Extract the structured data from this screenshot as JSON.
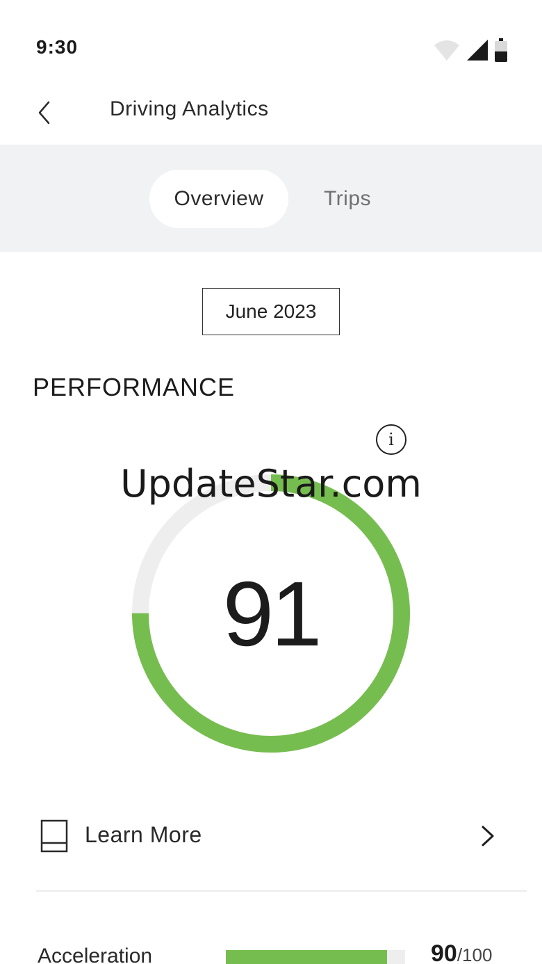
{
  "status_bar": {
    "time": "9:30",
    "icons": [
      "wifi-icon",
      "signal-icon",
      "battery-icon"
    ],
    "battery_level": 0.5
  },
  "header": {
    "title": "Driving Analytics",
    "back_icon": "chevron-left-icon"
  },
  "tabs": [
    {
      "label": "Overview",
      "active": true
    },
    {
      "label": "Trips",
      "active": false
    }
  ],
  "period": {
    "label": "June 2023"
  },
  "performance": {
    "title": "PERFORMANCE",
    "info_label": "i",
    "score": "91",
    "score_fraction": 0.75,
    "colors": {
      "progress": "#76bd4f",
      "track": "#eeeeee"
    }
  },
  "watermark": "UpdateStar.com",
  "learn_more": {
    "label": "Learn More",
    "icon": "book-icon"
  },
  "metrics": [
    {
      "label": "Acceleration",
      "score": "90",
      "max": "/100",
      "fraction": 0.9
    }
  ]
}
